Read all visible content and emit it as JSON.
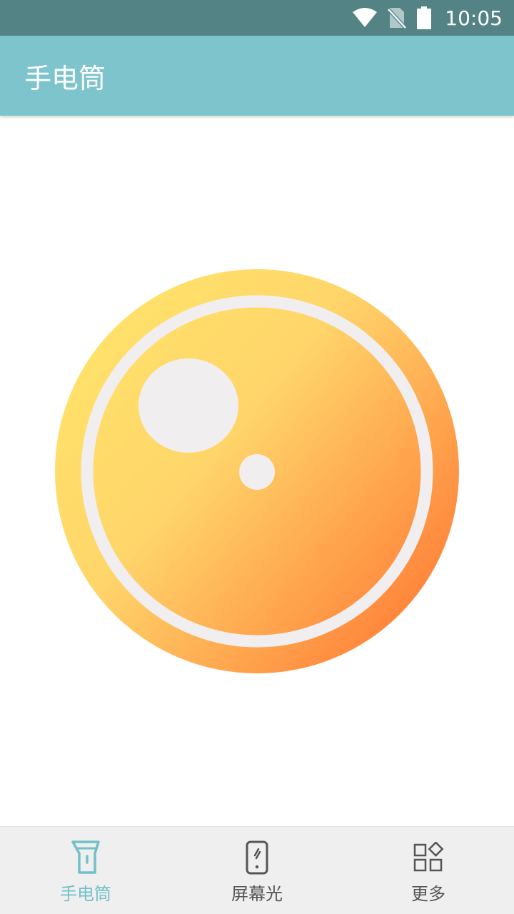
{
  "status_bar": {
    "time": "10:05",
    "icons": [
      "wifi-icon",
      "no-sim-icon",
      "battery-icon"
    ]
  },
  "app_bar": {
    "title": "手电筒"
  },
  "flash_button": {
    "icon": "flashlight-lens-icon"
  },
  "bottom_nav": {
    "items": [
      {
        "label": "手电筒",
        "icon": "flashlight-icon",
        "active": true
      },
      {
        "label": "屏幕光",
        "icon": "phone-screen-icon",
        "active": false
      },
      {
        "label": "更多",
        "icon": "grid-more-icon",
        "active": false
      }
    ]
  },
  "colors": {
    "status_bar": "#548386",
    "app_bar": "#7dc4cc",
    "accent": "#72c0c9",
    "gradient_start": "#ffe06a",
    "gradient_end": "#ff7e37",
    "highlight": "#f0eeef"
  }
}
